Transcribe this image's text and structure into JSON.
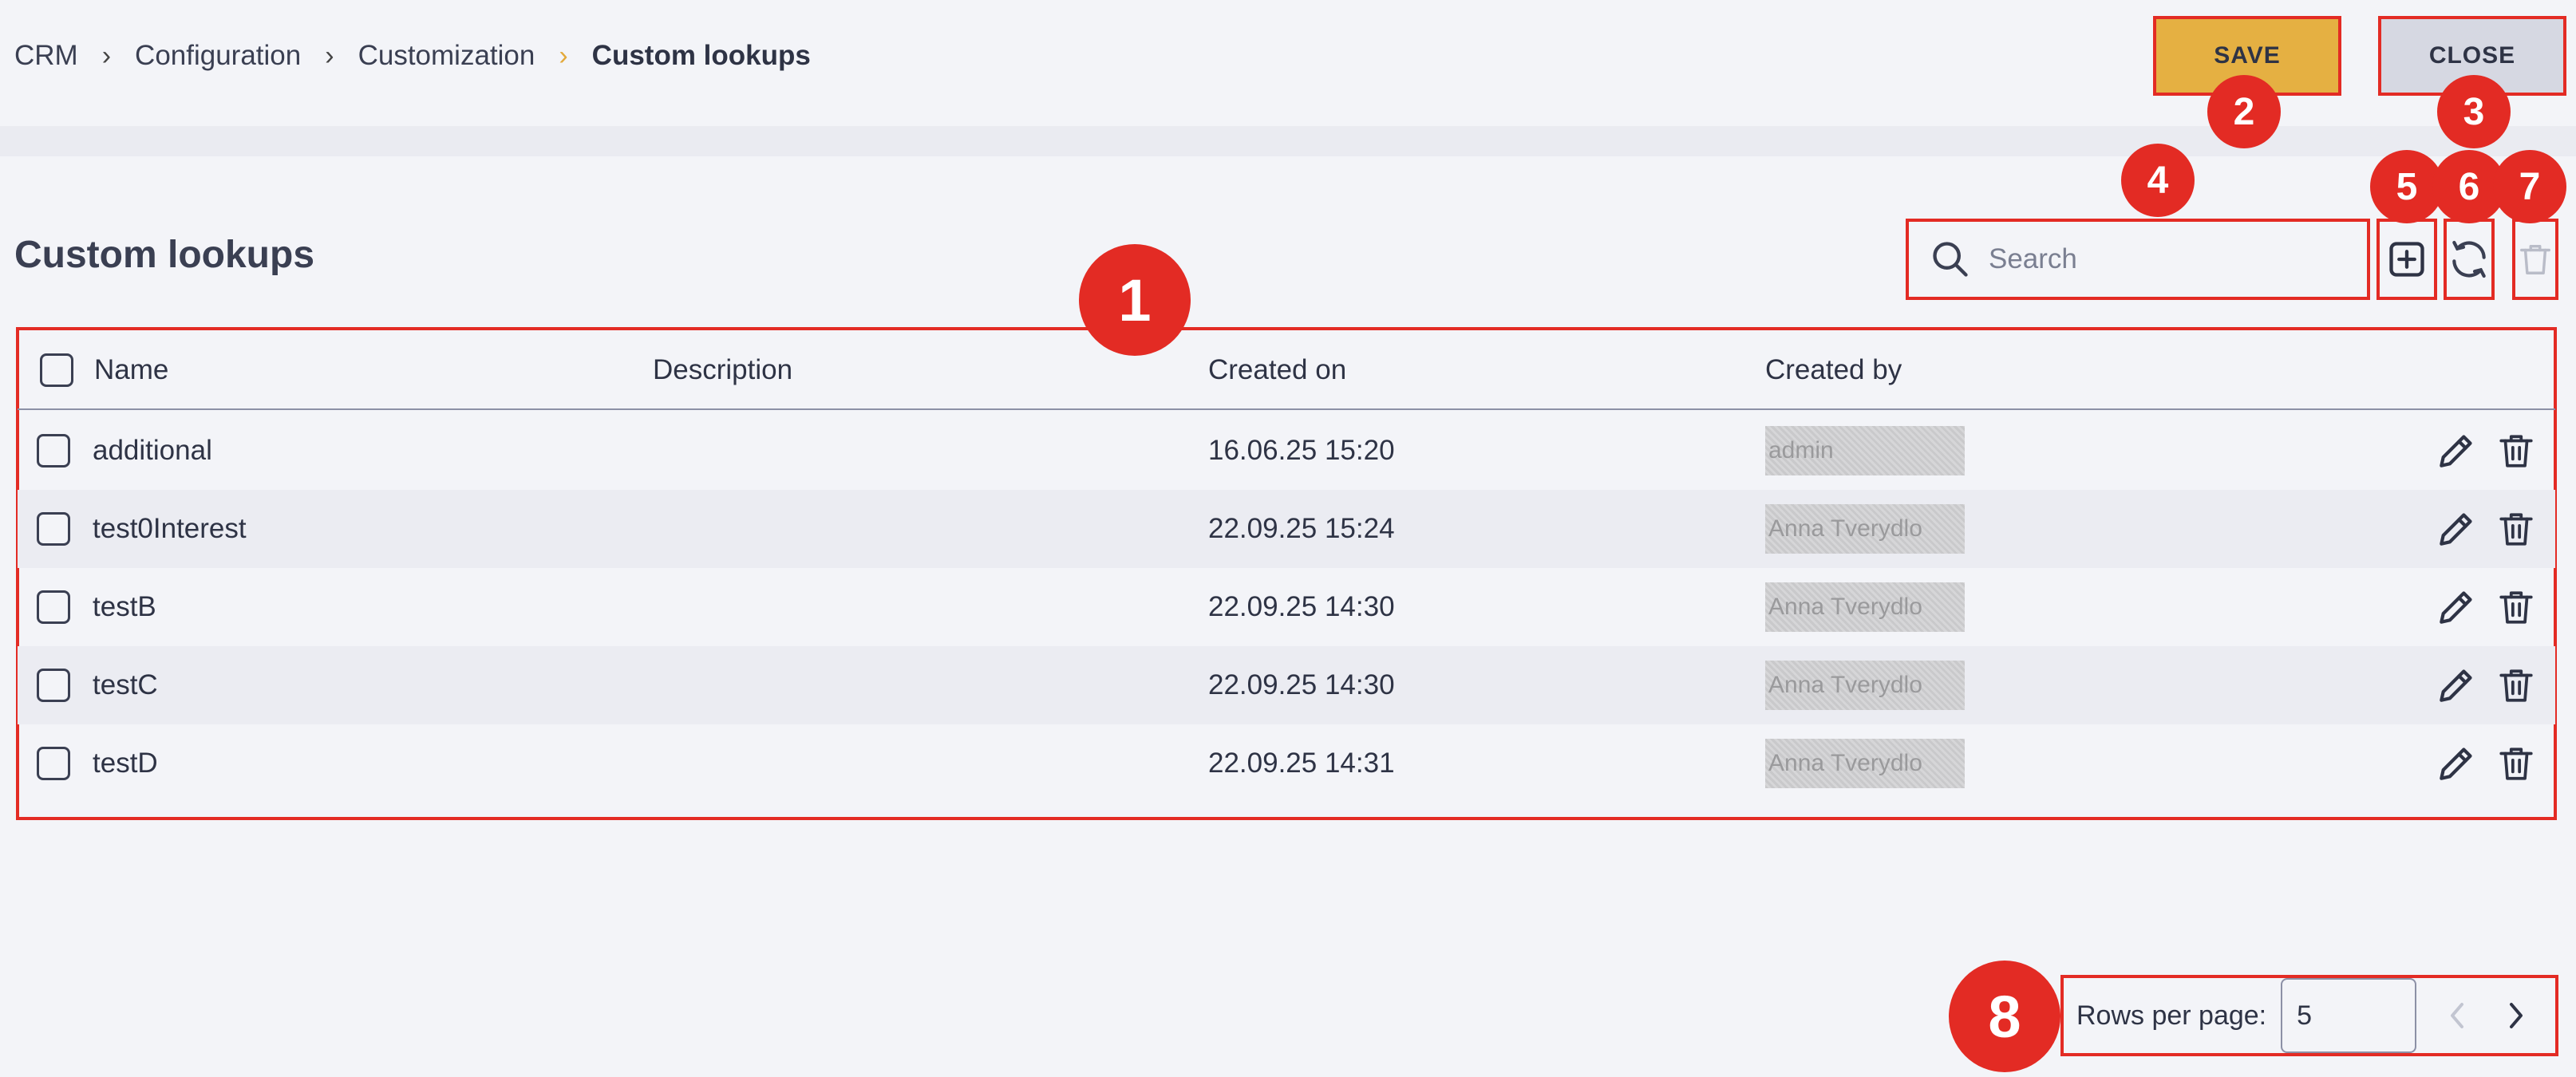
{
  "breadcrumb": {
    "items": [
      "CRM",
      "Configuration",
      "Customization"
    ],
    "current": "Custom lookups"
  },
  "toolbar": {
    "save_label": "SAVE",
    "close_label": "CLOSE"
  },
  "page": {
    "title": "Custom lookups"
  },
  "search": {
    "placeholder": "Search"
  },
  "table": {
    "columns": [
      "Name",
      "Description",
      "Created on",
      "Created by"
    ],
    "rows": [
      {
        "name": "additional",
        "description": "",
        "created_on": "16.06.25 15:20",
        "created_by": "admin"
      },
      {
        "name": "test0Interest",
        "description": "",
        "created_on": "22.09.25 15:24",
        "created_by": "Anna Tverydlo"
      },
      {
        "name": "testB",
        "description": "",
        "created_on": "22.09.25 14:30",
        "created_by": "Anna Tverydlo"
      },
      {
        "name": "testC",
        "description": "",
        "created_on": "22.09.25 14:30",
        "created_by": "Anna Tverydlo"
      },
      {
        "name": "testD",
        "description": "",
        "created_on": "22.09.25 14:31",
        "created_by": "Anna Tverydlo"
      }
    ]
  },
  "pagination": {
    "rows_label": "Rows per page:",
    "rows_value": "5"
  },
  "annotations": [
    "1",
    "2",
    "3",
    "4",
    "5",
    "6",
    "7",
    "8"
  ],
  "colors": {
    "accent": "#e5b042",
    "annotation": "#e32b24",
    "text": "#2e3345",
    "background": "#f3f4f8"
  }
}
